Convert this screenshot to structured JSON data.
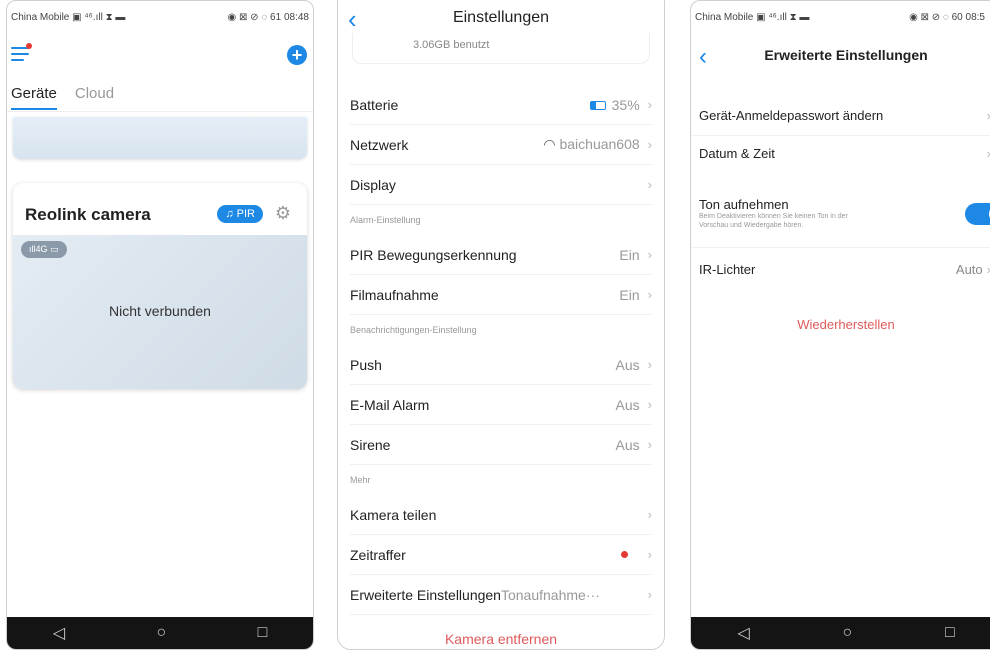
{
  "screen1": {
    "status": {
      "carrier": "China Mobile",
      "icons_left": "▣ ⁴⁶.ıll ⧗ ▬",
      "icons_right": "◉ ⊠ ⊘ ◌ 61",
      "time": "08:48"
    },
    "tabs": [
      "Geräte",
      "Cloud"
    ],
    "camera": {
      "name": "Reolink camera",
      "pir_label": "PIR",
      "signal": "ıll4G ▭",
      "status": "Nicht verbunden"
    }
  },
  "screen2": {
    "title": "Einstellungen",
    "storage": "3.06GB benutzt",
    "rows": [
      {
        "label": "Batterie",
        "value": "35%"
      },
      {
        "label": "Netzwerk",
        "value": "baichuan608"
      },
      {
        "label": "Display",
        "value": ""
      }
    ],
    "section_alarm": "Alarm-Einstellung",
    "alarm_rows": [
      {
        "label": "PIR Bewegungserkennung",
        "value": "Ein"
      },
      {
        "label": "Filmaufnahme",
        "value": "Ein"
      }
    ],
    "section_notify": "Benachrichtigungen-Einstellung",
    "notify_rows": [
      {
        "label": "Push",
        "value": "Aus"
      },
      {
        "label": "E-Mail Alarm",
        "value": "Aus"
      },
      {
        "label": "Sirene",
        "value": "Aus"
      }
    ],
    "section_more": "Mehr",
    "more_rows": [
      {
        "label": "Kamera teilen",
        "value": ""
      },
      {
        "label": "Zeitraffer",
        "value": ""
      },
      {
        "label": "Erweiterte Einstellungen",
        "value": "Tonaufnahme···"
      }
    ],
    "remove": "Kamera entfernen",
    "battery_percent": 35
  },
  "screen3": {
    "status": {
      "carrier": "China Mobile",
      "icons_left": "▣ ⁴⁶.ıll ⧗ ▬",
      "icons_right": "◉ ⊠ ⊘ ◌ 60",
      "time": "08:5"
    },
    "title": "Erweiterte Einstellungen",
    "password": "Gerät-Anmeldepasswort ändern",
    "datetime": "Datum & Zeit",
    "sound_label": "Ton aufnehmen",
    "sound_hint_1": "Beim Deaktivieren können Sie keinen Ton in der",
    "sound_hint_2": "Vorschau und Wiedergabe hören.",
    "ir_label": "IR-Lichter",
    "ir_value": "Auto",
    "restore": "Wiederherstellen",
    "sound_enabled": true
  },
  "colors": {
    "accent": "#1e88e5",
    "danger": "#e05a5a"
  }
}
